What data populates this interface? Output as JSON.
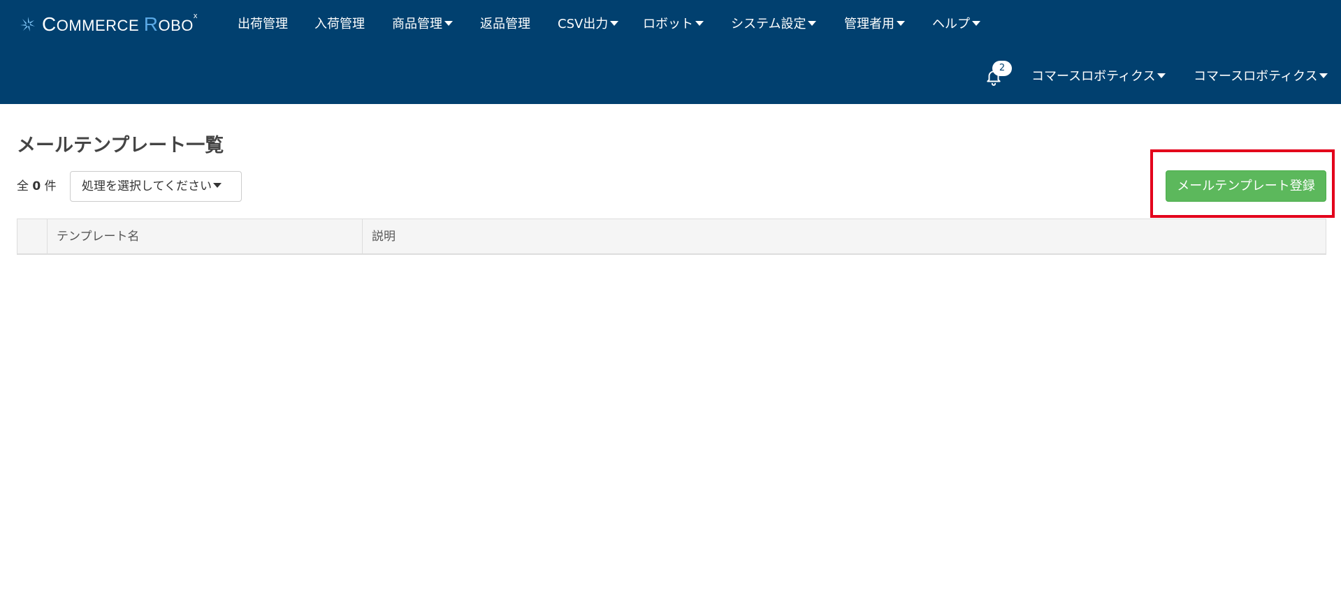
{
  "brand": {
    "logo_c": "C",
    "logo_rest1": "OMMERCE ",
    "logo_r": "R",
    "logo_rest2": "OBO",
    "logo_mark": "x"
  },
  "nav": {
    "items": [
      {
        "label": "出荷管理",
        "dropdown": false
      },
      {
        "label": "入荷管理",
        "dropdown": false
      },
      {
        "label": "商品管理",
        "dropdown": true
      },
      {
        "label": "返品管理",
        "dropdown": false
      },
      {
        "label": "CSV出力",
        "dropdown": true
      },
      {
        "label": "ロボット",
        "dropdown": true
      },
      {
        "label": "システム設定",
        "dropdown": true
      },
      {
        "label": "管理者用",
        "dropdown": true
      },
      {
        "label": "ヘルプ",
        "dropdown": true
      }
    ],
    "notifications_count": "2",
    "user_menus": [
      "コマースロボティクス",
      "コマースロボティクス"
    ]
  },
  "main": {
    "page_title": "メールテンプレート一覧",
    "count_prefix": "全",
    "count_value": "0",
    "count_suffix": "件",
    "bulk_action_placeholder": "処理を選択してください",
    "register_button_label": "メールテンプレート登録",
    "table": {
      "columns": [
        "",
        "テンプレート名",
        "説明"
      ],
      "rows": []
    }
  },
  "colors": {
    "header_bg": "#01406f",
    "primary_action": "#5cb85c",
    "highlight_outline": "#e3001b"
  },
  "icons": {
    "notification": "bell-icon",
    "dropdown": "caret-down-icon"
  }
}
